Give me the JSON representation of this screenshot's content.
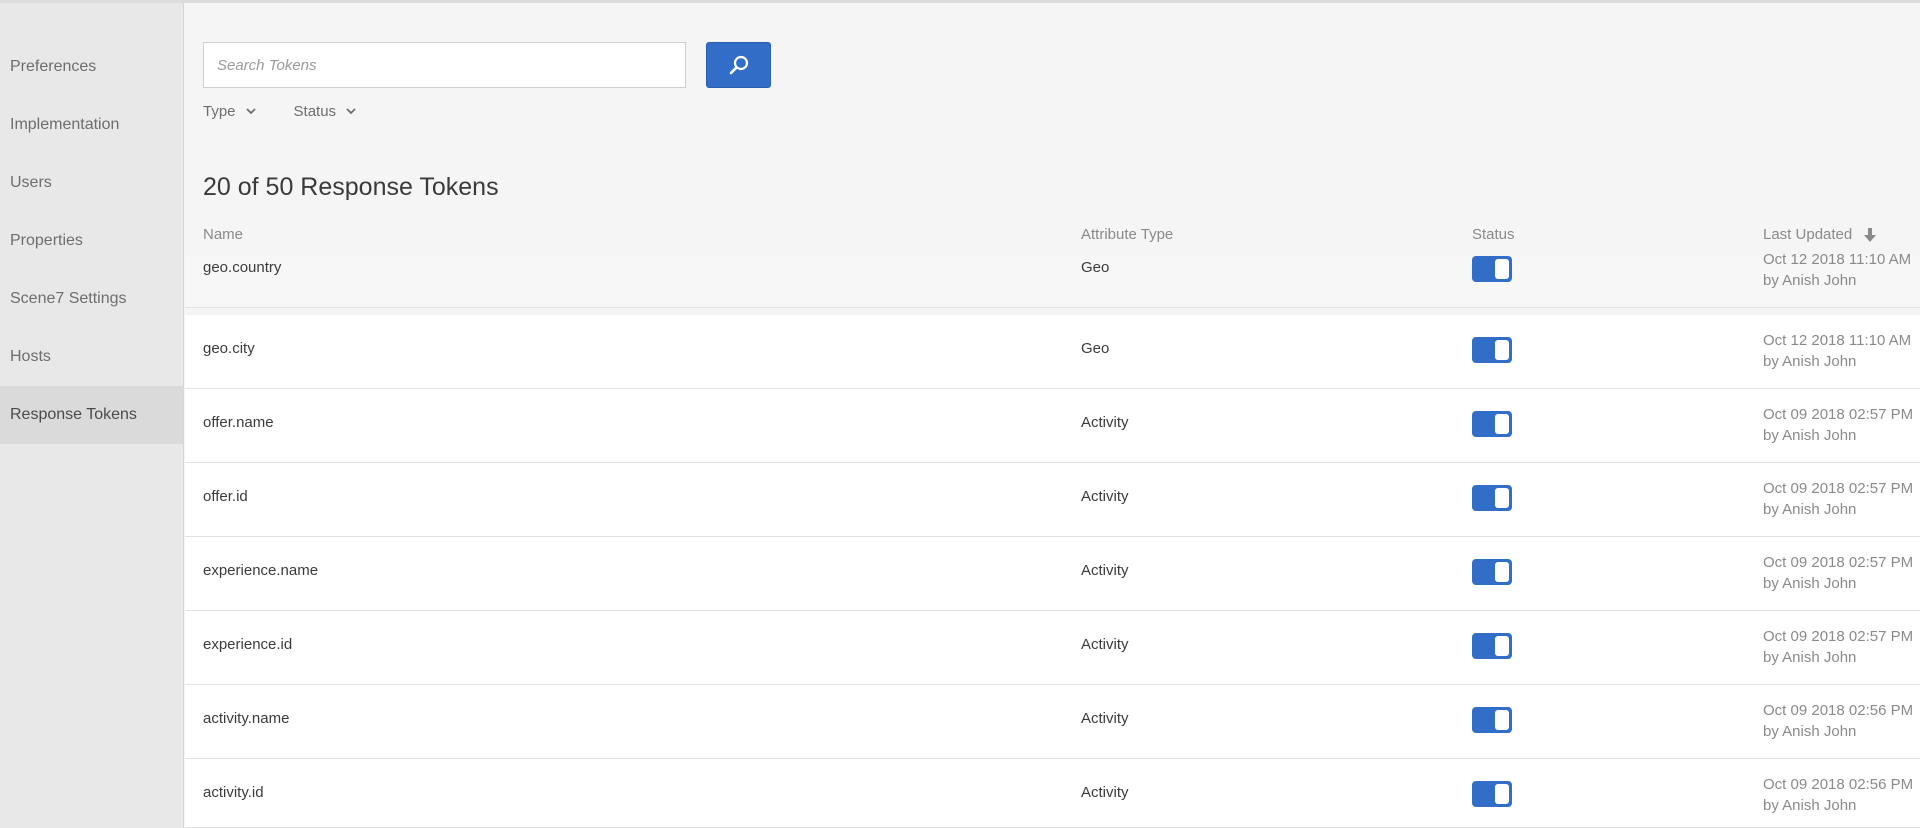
{
  "sidebar": {
    "items": [
      {
        "label": "Preferences"
      },
      {
        "label": "Implementation"
      },
      {
        "label": "Users"
      },
      {
        "label": "Properties"
      },
      {
        "label": "Scene7 Settings"
      },
      {
        "label": "Hosts"
      },
      {
        "label": "Response Tokens",
        "active": true
      }
    ]
  },
  "search": {
    "placeholder": "Search Tokens",
    "value": ""
  },
  "filters": {
    "type_label": "Type",
    "status_label": "Status"
  },
  "results": {
    "title": "20 of 50 Response Tokens"
  },
  "table": {
    "columns": {
      "name": "Name",
      "attribute_type": "Attribute Type",
      "status": "Status",
      "last_updated": "Last Updated"
    },
    "sort_direction": "descending",
    "rows": [
      {
        "name": "geo.country",
        "type": "Geo",
        "enabled": true,
        "date": "Oct 12 2018 11:10 AM",
        "by": "by Anish John"
      },
      {
        "name": "geo.city",
        "type": "Geo",
        "enabled": true,
        "date": "Oct 12 2018 11:10 AM",
        "by": "by Anish John"
      },
      {
        "name": "offer.name",
        "type": "Activity",
        "enabled": true,
        "date": "Oct 09 2018 02:57 PM",
        "by": "by Anish John"
      },
      {
        "name": "offer.id",
        "type": "Activity",
        "enabled": true,
        "date": "Oct 09 2018 02:57 PM",
        "by": "by Anish John"
      },
      {
        "name": "experience.name",
        "type": "Activity",
        "enabled": true,
        "date": "Oct 09 2018 02:57 PM",
        "by": "by Anish John"
      },
      {
        "name": "experience.id",
        "type": "Activity",
        "enabled": true,
        "date": "Oct 09 2018 02:57 PM",
        "by": "by Anish John"
      },
      {
        "name": "activity.name",
        "type": "Activity",
        "enabled": true,
        "date": "Oct 09 2018 02:56 PM",
        "by": "by Anish John"
      },
      {
        "name": "activity.id",
        "type": "Activity",
        "enabled": true,
        "date": "Oct 09 2018 02:56 PM",
        "by": "by Anish John"
      }
    ]
  },
  "colors": {
    "accent": "#326ec8",
    "sidebar_bg": "#e8e8e8",
    "sidebar_active_bg": "#dadada",
    "page_bg": "#f5f5f5"
  },
  "icons": {
    "search_button": "search-icon",
    "filter_dropdown": "chevron-down-icon",
    "sort_indicator": "sort-descending-icon"
  }
}
